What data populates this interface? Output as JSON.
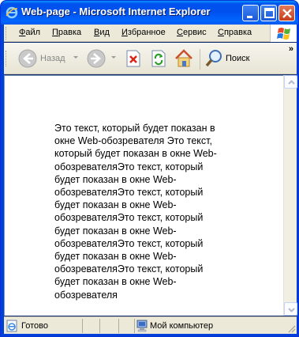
{
  "window": {
    "title": "Web-page - Microsoft Internet Explorer"
  },
  "menu": {
    "items": [
      {
        "accel": "Ф",
        "rest": "айл"
      },
      {
        "accel": "П",
        "rest": "равка"
      },
      {
        "accel": "В",
        "rest": "ид"
      },
      {
        "accel": "И",
        "rest": "збранное"
      },
      {
        "accel": "С",
        "rest": "ервис"
      },
      {
        "accel": "С",
        "rest": "правка"
      }
    ]
  },
  "toolbar": {
    "back_label": "Назад",
    "search_label": "Поиск",
    "more": "»"
  },
  "content": {
    "text": "Это текст, который будет показан в окне Web-обозревателя Это текст, который будет показан в окне Web-обозревателяЭто текст, который будет показан в окне Web-обозревателяЭто текст, который будет показан в окне Web-обозревателяЭто текст, который будет показан в окне Web-обозревателяЭто текст, который будет показан в окне Web-обозревателяЭто текст, который будет показан в окне Web-обозревателя"
  },
  "status": {
    "ready": "Готово",
    "zone": "Мой компьютер"
  },
  "colors": {
    "titlebar": "#0053ee",
    "chrome": "#ece9d8",
    "close_button": "#c73d1a"
  }
}
